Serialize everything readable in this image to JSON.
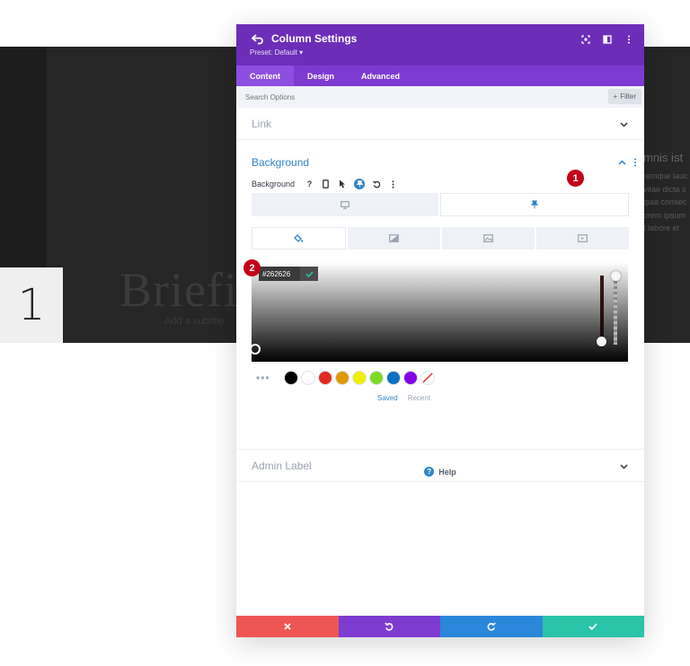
{
  "background_page": {
    "number": "1",
    "title": "Briefi",
    "subtitle": "Add a subtitle",
    "right_heading": "mnis ist",
    "right_lines": [
      "remque lauc",
      "vitae dicta s",
      "quia consec",
      "orem ipsum",
      "t labore et"
    ]
  },
  "modal": {
    "title": "Column Settings",
    "preset": "Preset: Default ▾",
    "tabs": [
      {
        "label": "Content",
        "active": true
      },
      {
        "label": "Design",
        "active": false
      },
      {
        "label": "Advanced",
        "active": false
      }
    ],
    "search": {
      "placeholder": "Search Options",
      "filter_label": "Filter"
    },
    "sections": {
      "link": "Link",
      "background": "Background",
      "admin_label": "Admin Label"
    },
    "background": {
      "option_label": "Background",
      "hex_value": "#262626",
      "swatches": [
        "#000000",
        "#ffffff",
        "#e02b20",
        "#e09900",
        "#edf000",
        "#7cda24",
        "#0c71c3",
        "#8300e9"
      ],
      "swatch_tabs": {
        "saved": "Saved",
        "recent": "Recent"
      }
    },
    "markers": [
      "1",
      "2"
    ],
    "help": "Help",
    "colors": {
      "header": "#6c2eb9",
      "tabs": "#7d3bd1",
      "accent": "#2f85c8",
      "cancel": "#ef5555",
      "undo": "#7e3bd0",
      "redo": "#2b87da",
      "save": "#29c4a9"
    }
  }
}
